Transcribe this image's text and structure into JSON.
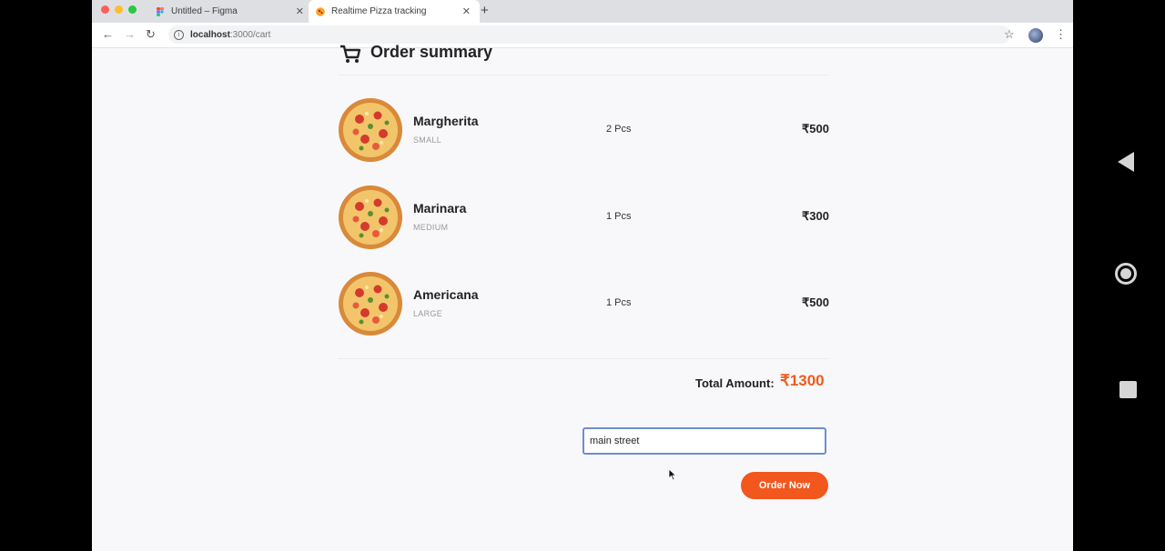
{
  "browser": {
    "tabs": [
      {
        "title": "Untitled – Figma",
        "active": false
      },
      {
        "title": "Realtime Pizza tracking",
        "active": true
      }
    ],
    "url_host": "localhost",
    "url_path": ":3000/cart"
  },
  "page": {
    "title": "Order summary",
    "items": [
      {
        "name": "Margherita",
        "size": "SMALL",
        "qty": "2 Pcs",
        "price": "₹500"
      },
      {
        "name": "Marinara",
        "size": "MEDIUM",
        "qty": "1 Pcs",
        "price": "₹300"
      },
      {
        "name": "Americana",
        "size": "LARGE",
        "qty": "1 Pcs",
        "price": "₹500"
      }
    ],
    "total_label": "Total Amount:",
    "total_value": "₹1300",
    "address_value": "main street",
    "order_button": "Order Now"
  },
  "colors": {
    "accent": "#f2571d",
    "total": "#f05a1a",
    "input_border": "#6b8ed1"
  },
  "icons": {
    "cart": "cart-icon",
    "pizza": "pizza-image",
    "android_nav": [
      "back-icon",
      "home-icon",
      "recents-icon"
    ]
  }
}
